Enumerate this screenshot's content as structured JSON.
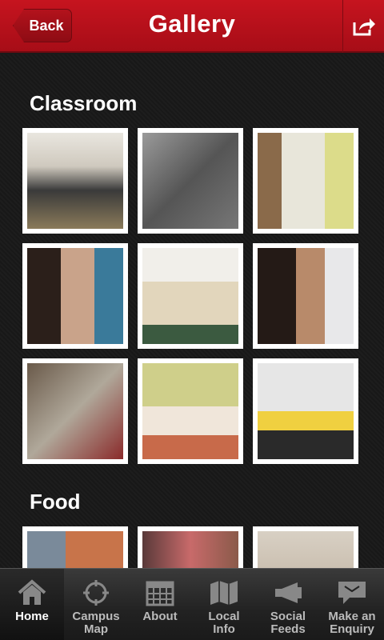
{
  "header": {
    "back_label": "Back",
    "title": "Gallery"
  },
  "sections": [
    {
      "title": "Classroom"
    },
    {
      "title": "Food"
    }
  ],
  "tabs": [
    {
      "label": "Home",
      "icon": "home-icon"
    },
    {
      "label": "Campus\nMap",
      "icon": "crosshair-icon"
    },
    {
      "label": "About",
      "icon": "calendar-icon"
    },
    {
      "label": "Local\nInfo",
      "icon": "map-icon"
    },
    {
      "label": "Social\nFeeds",
      "icon": "megaphone-icon"
    },
    {
      "label": "Make an\nEnquiry",
      "icon": "chat-icon"
    }
  ],
  "colors": {
    "header": "#c6141f",
    "background": "#1a1a1a",
    "tabbar": "#2a2a2a"
  }
}
